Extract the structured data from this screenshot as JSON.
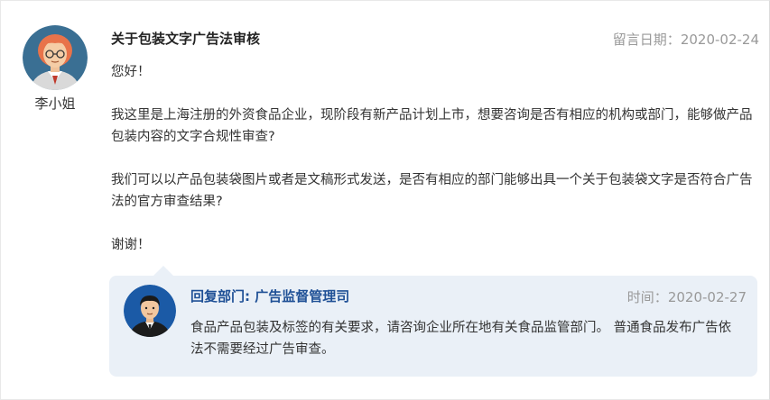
{
  "message": {
    "title": "关于包装文字广告法审核",
    "date_label": "留言日期：",
    "date": "2020-02-24",
    "author": "李小姐",
    "paragraphs": [
      "您好！",
      "我这里是上海注册的外资食品企业，现阶段有新产品计划上市，想要咨询是否有相应的机构或部门，能够做产品包装内容的文字合规性审查?",
      "我们可以以产品包装袋图片或者是文稿形式发送，是否有相应的部门能够出具一个关于包装袋文字是否符合广告法的官方审查结果?",
      "谢谢！"
    ]
  },
  "reply": {
    "department": "回复部门: 广告监督管理司",
    "time_label": "时间：",
    "time": "2020-02-27",
    "content": "食品产品包装及标签的有关要求，请咨询企业所在地有关食品监管部门。 普通食品发布广告依法不需要经过广告审查。"
  },
  "colors": {
    "reply_bg": "#eaf0f7",
    "department": "#1f5096",
    "muted": "#999999"
  }
}
